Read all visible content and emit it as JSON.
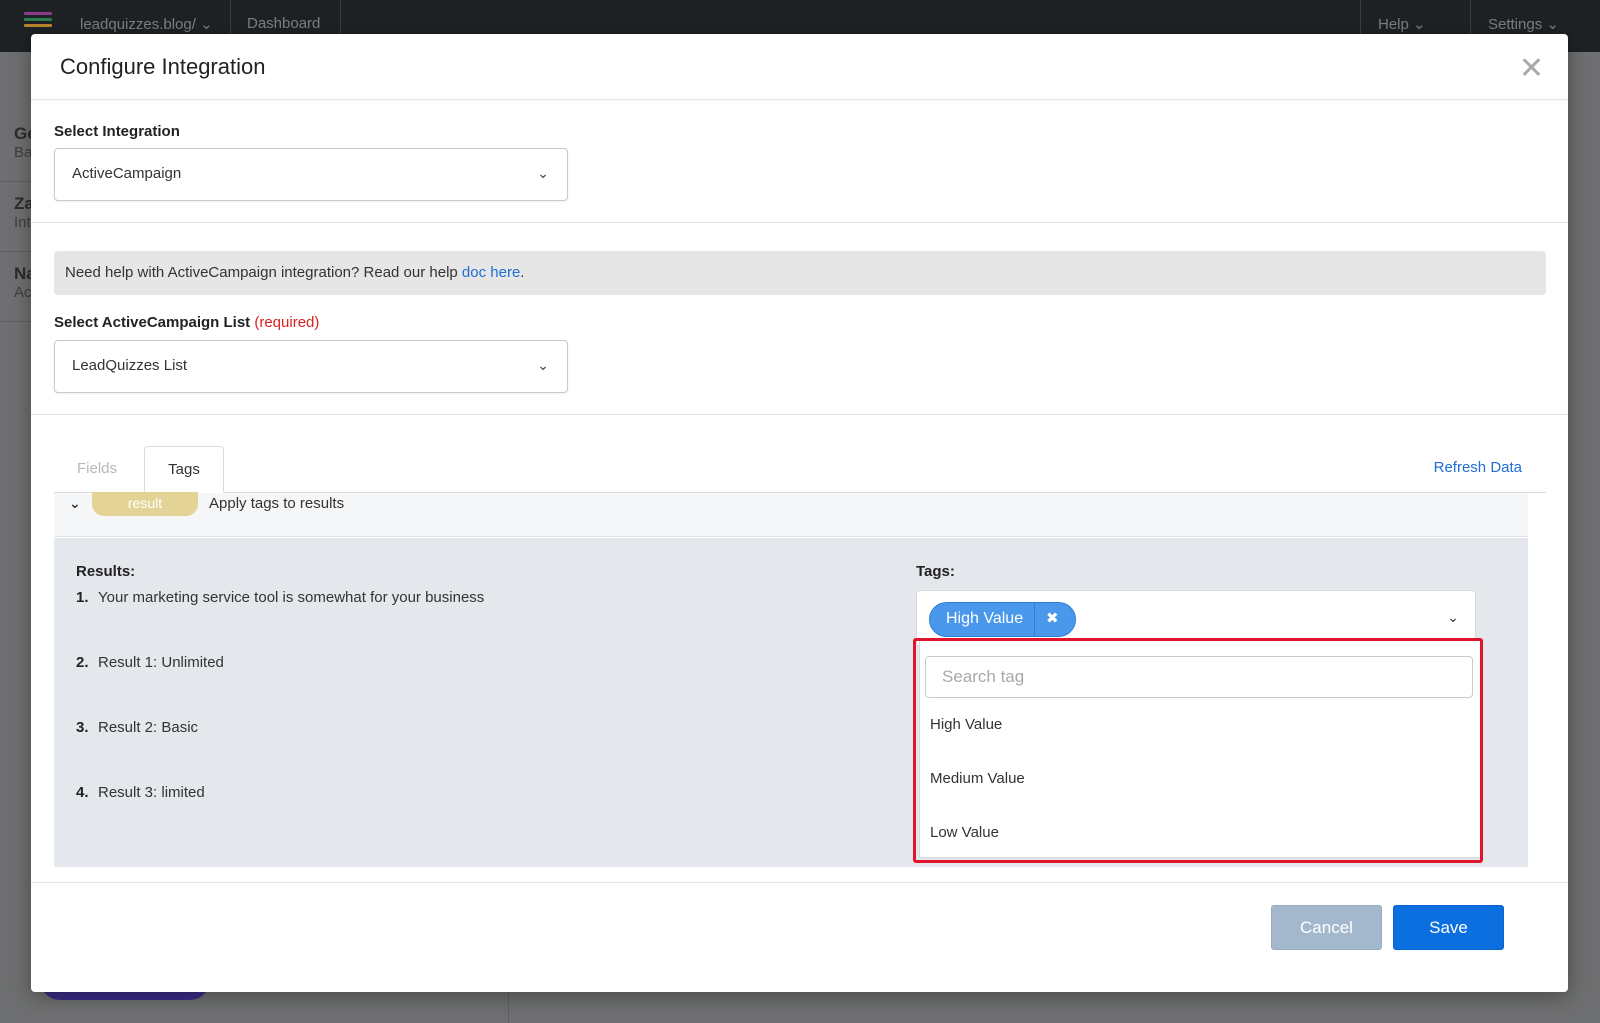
{
  "background": {
    "site_selector": "leadquizzes.blog/",
    "nav_dashboard": "Dashboard",
    "nav_help": "Help",
    "nav_settings": "Settings",
    "sidebar": [
      {
        "title": "Ge",
        "sub": "Ba"
      },
      {
        "title": "Za",
        "sub": "Int"
      },
      {
        "title": "Na",
        "sub": "Ac"
      }
    ]
  },
  "modal": {
    "title": "Configure Integration",
    "close_glyph": "✕",
    "select_integration": {
      "label": "Select Integration",
      "value": "ActiveCampaign"
    },
    "help": {
      "text": "Need help with ActiveCampaign integration? Read our help ",
      "link_text": "doc here",
      "suffix": "."
    },
    "list_select": {
      "label": "Select ActiveCampaign List",
      "required_text": "(required)",
      "value": "LeadQuizzes List"
    },
    "tabs": [
      {
        "label": "Fields",
        "active": false
      },
      {
        "label": "Tags",
        "active": true
      }
    ],
    "refresh_label": "Refresh Data",
    "accordion": {
      "pill_label": "result",
      "title": "Apply tags to results",
      "results_title": "Results:",
      "results": [
        {
          "num": "1.",
          "text": "Your marketing service tool is somewhat for your business"
        },
        {
          "num": "2.",
          "text": "Result 1: Unlimited"
        },
        {
          "num": "3.",
          "text": "Result 2: Basic"
        },
        {
          "num": "4.",
          "text": "Result 3: limited"
        }
      ],
      "tags_title": "Tags:",
      "selected_tag": "High Value",
      "search_placeholder": "Search tag",
      "options": [
        "High Value",
        "Medium Value",
        "Low Value"
      ]
    },
    "footer": {
      "cancel_label": "Cancel",
      "save_label": "Save"
    }
  },
  "colors": {
    "accent": "#0c6fdf",
    "link": "#1f6fd6",
    "chip": "#4a98ec",
    "highlight": "#e0142a",
    "required": "#e02020",
    "pill": "#e3d496"
  }
}
